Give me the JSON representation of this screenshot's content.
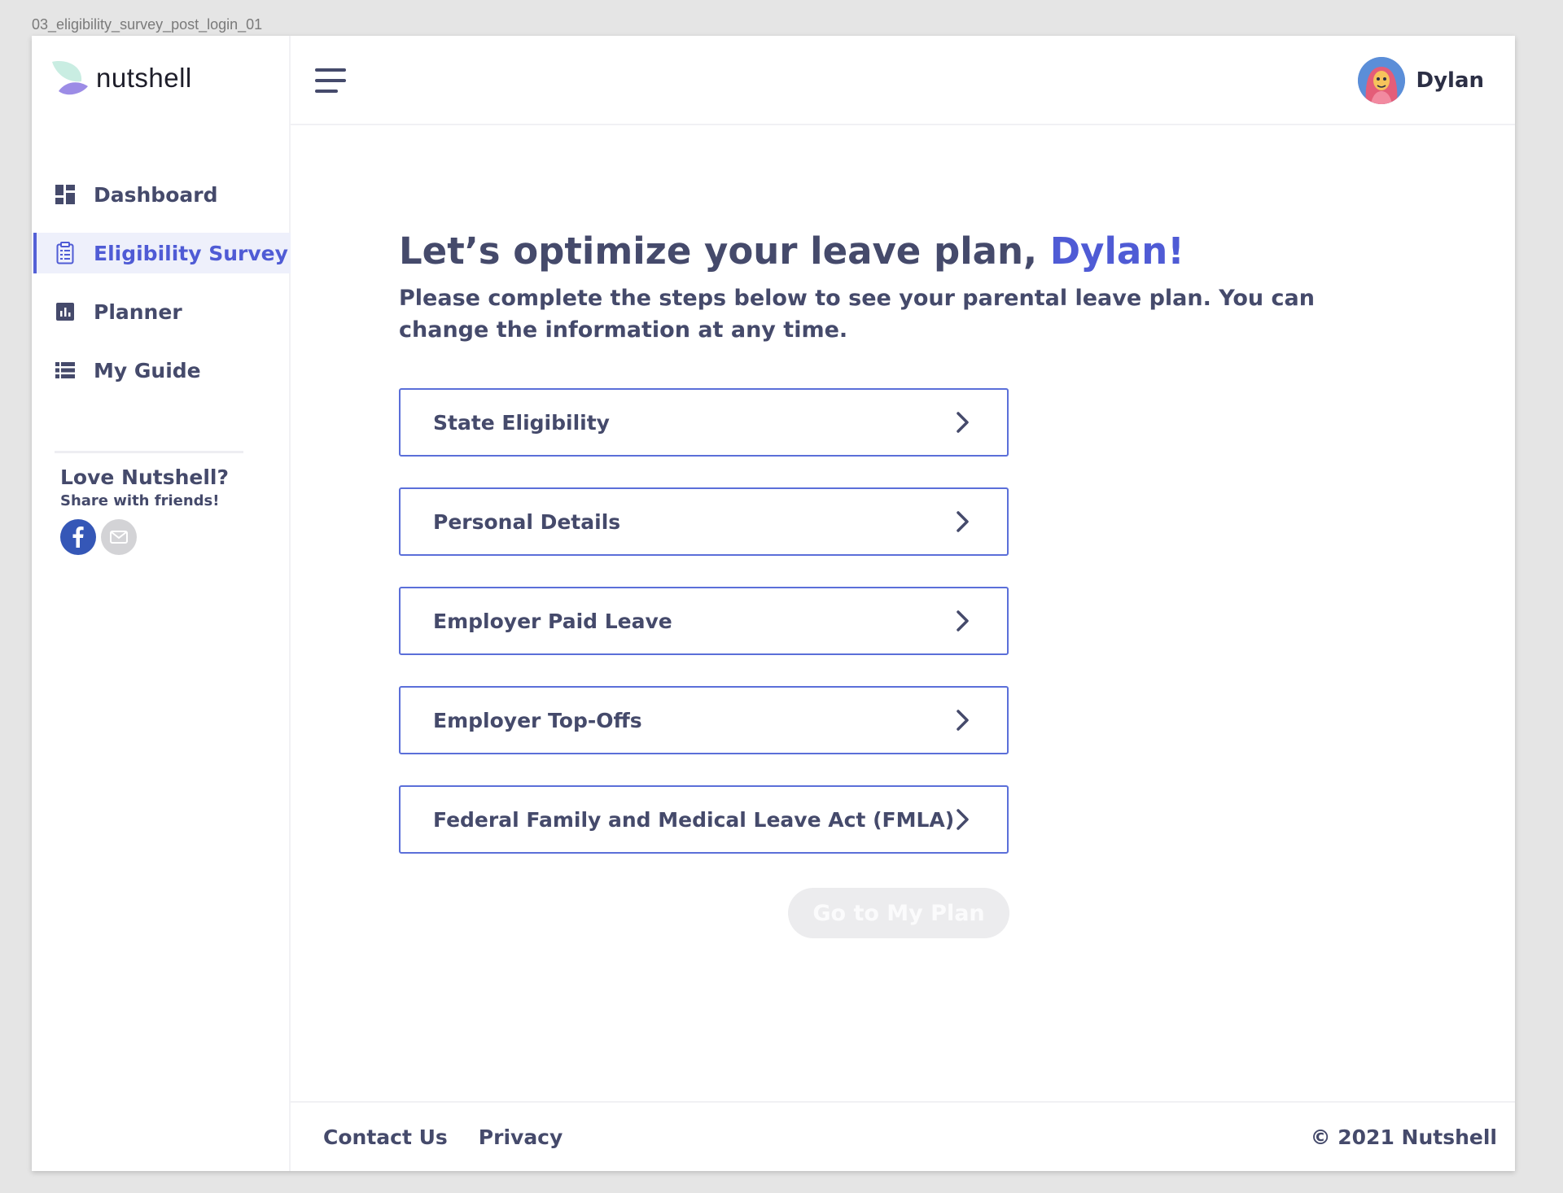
{
  "artboard_label": "03_eligibility_survey_post_login_01",
  "brand": {
    "name": "nutshell"
  },
  "colors": {
    "accent": "#4f5bd5",
    "text": "#454a6b",
    "facebook": "#3557b7"
  },
  "sidebar": {
    "items": [
      {
        "label": "Dashboard",
        "icon": "dashboard-icon",
        "active": false
      },
      {
        "label": "Eligibility Survey",
        "icon": "clipboard-icon",
        "active": true
      },
      {
        "label": "Planner",
        "icon": "bar-chart-icon",
        "active": false
      },
      {
        "label": "My Guide",
        "icon": "list-icon",
        "active": false
      }
    ],
    "share": {
      "title": "Love Nutshell?",
      "subtitle": "Share with friends!",
      "buttons": [
        "facebook-icon",
        "mail-icon"
      ]
    }
  },
  "header": {
    "user_name": "Dylan"
  },
  "main": {
    "headline_prefix": "Let’s optimize your leave plan, ",
    "headline_name": "Dylan!",
    "subline": "Please complete the steps below to see your parental leave plan. You can change the information at any time.",
    "steps": [
      {
        "label": "State Eligibility"
      },
      {
        "label": "Personal Details"
      },
      {
        "label": "Employer Paid Leave"
      },
      {
        "label": "Employer Top-Offs"
      },
      {
        "label": "Federal Family and Medical Leave Act (FMLA)"
      }
    ],
    "cta": "Go to My Plan"
  },
  "footer": {
    "links": [
      "Contact Us",
      "Privacy"
    ],
    "copyright": "© 2021 Nutshell"
  }
}
